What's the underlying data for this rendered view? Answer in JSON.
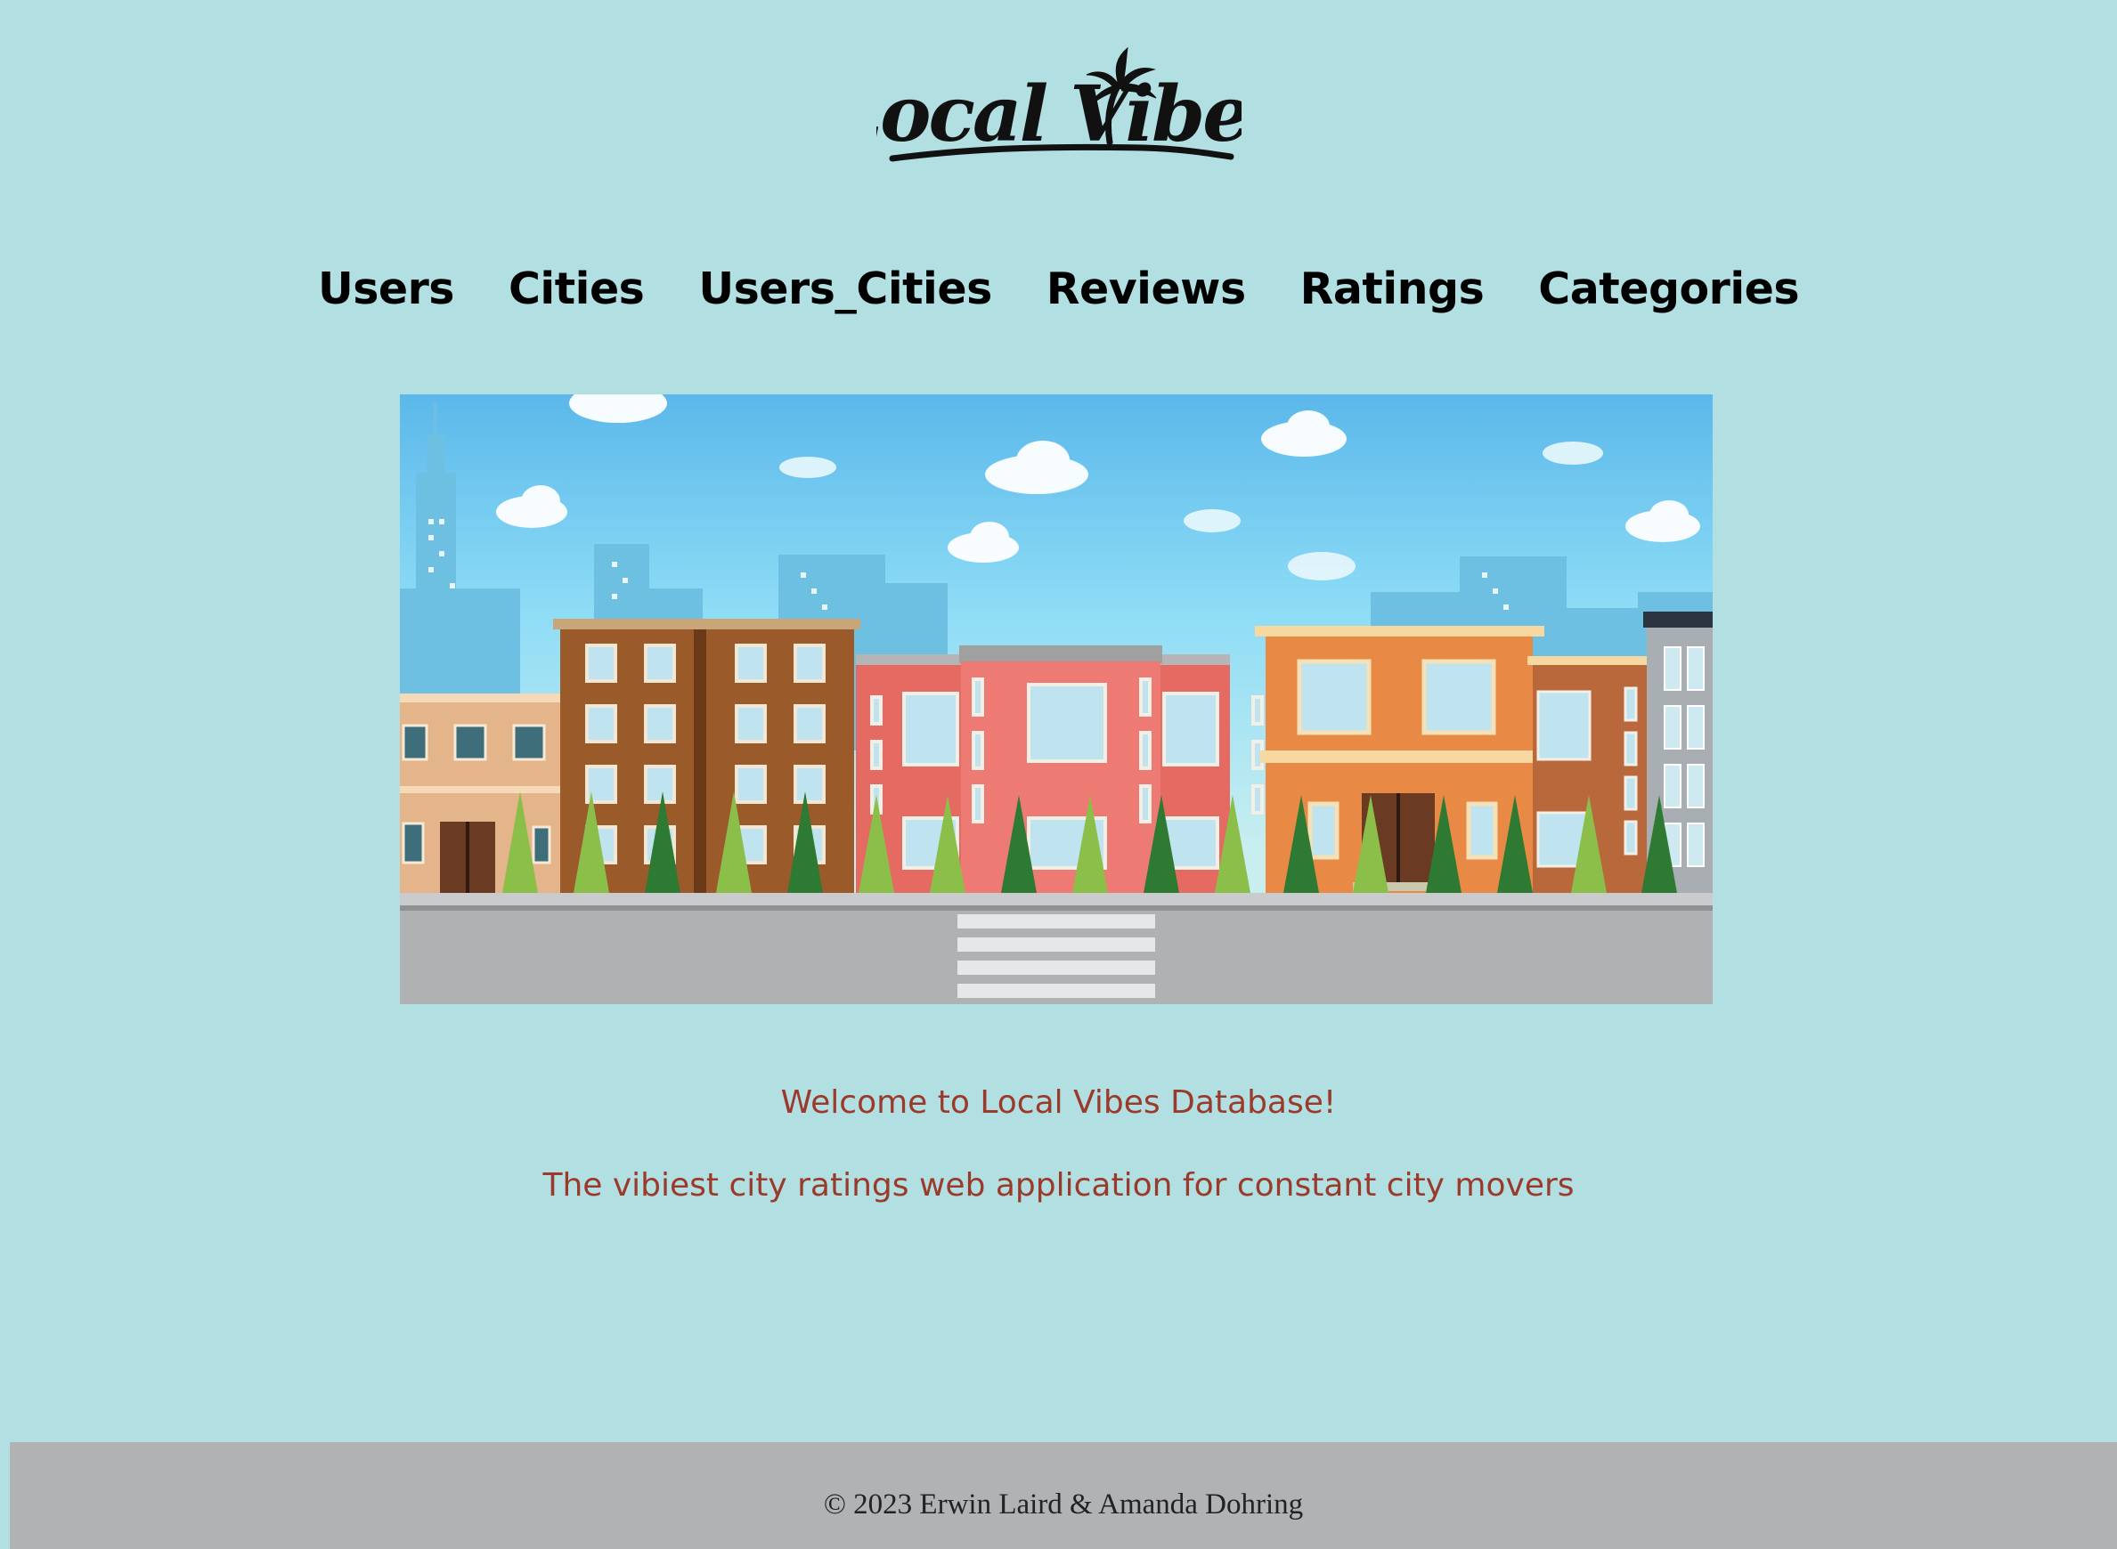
{
  "logo": {
    "text": "Local Vibes"
  },
  "nav": {
    "items": [
      {
        "label": "Users"
      },
      {
        "label": "Cities"
      },
      {
        "label": "Users_Cities"
      },
      {
        "label": "Reviews"
      },
      {
        "label": "Ratings"
      },
      {
        "label": "Categories"
      }
    ]
  },
  "hero": {
    "image": "city-street-illustration"
  },
  "welcome": {
    "title": "Welcome to Local Vibes Database!",
    "tagline": "The vibiest city ratings web application for constant city movers"
  },
  "footer": {
    "copyright": "© 2023 Erwin Laird & Amanda Dohring"
  },
  "colors": {
    "background": "#b2dfe1",
    "welcome_text": "#9b3a2a",
    "footer_bg": "#b1b2b4"
  }
}
